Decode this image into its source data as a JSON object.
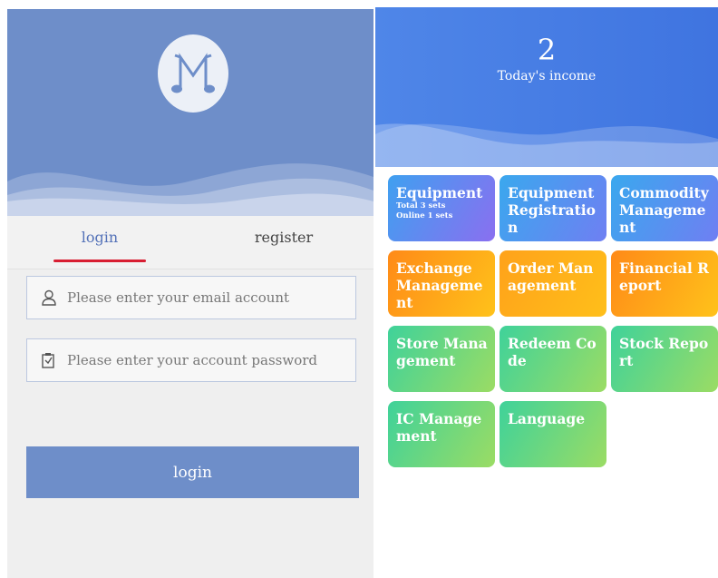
{
  "login_screen": {
    "tabs": [
      {
        "label": "login",
        "active": true
      },
      {
        "label": "register",
        "active": false
      }
    ],
    "email": {
      "placeholder": "Please enter your email account",
      "icon": "user-icon"
    },
    "password": {
      "placeholder": "Please enter your account password",
      "icon": "lock-icon"
    },
    "submit_label": "login",
    "logo_icon": "music-note-logo",
    "colors": {
      "primary": "#6e8ec9",
      "tab_indicator": "#d81e32"
    }
  },
  "dashboard": {
    "income": {
      "value": "2",
      "label": "Today's income"
    },
    "tiles": [
      {
        "label": "Equipment",
        "sub": [
          "Total 3 sets",
          "Online 1 sets"
        ]
      },
      {
        "label": "Equipment Registration"
      },
      {
        "label": "Commodity Management"
      },
      {
        "label": "Exchange Management"
      },
      {
        "label": "Order Management"
      },
      {
        "label": "Financial Report"
      },
      {
        "label": "Store Management"
      },
      {
        "label": "Redeem Code"
      },
      {
        "label": "Stock Report"
      },
      {
        "label": "IC Management"
      },
      {
        "label": "Language"
      }
    ],
    "colors": {
      "header": "#4f86e8",
      "blue_tiles": "#3fa0f0",
      "orange_tiles": "#ffa21a",
      "green_tiles": "#3fd29a"
    }
  }
}
